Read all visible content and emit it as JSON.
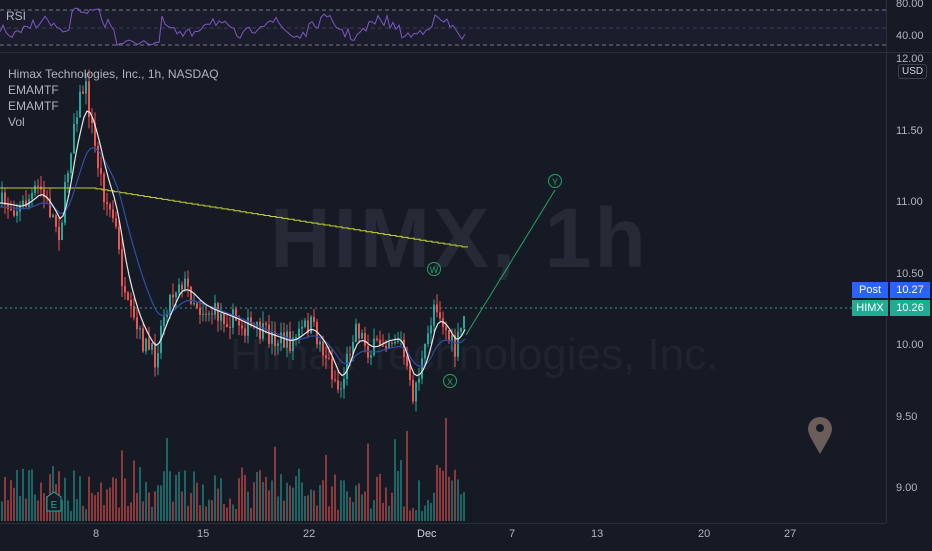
{
  "rsi": {
    "label": "RSI",
    "levels": [
      "80.00",
      "40.00"
    ]
  },
  "legend": {
    "title": "Himax Technologies, Inc., 1h, NASDAQ",
    "indicators": [
      "EMAMTF",
      "EMAMTF",
      "Vol"
    ]
  },
  "watermark": {
    "symbol": "HIMX, 1h",
    "company": "Himax Technologies, Inc."
  },
  "price_axis": {
    "currency": "USD",
    "labels": [
      "12.00",
      "11.50",
      "11.00",
      "10.50",
      "10.00",
      "9.50",
      "9.00"
    ]
  },
  "time_axis": {
    "labels": [
      "8",
      "15",
      "22",
      "Dec",
      "7",
      "13",
      "20",
      "27"
    ]
  },
  "price_tags": {
    "post": {
      "name": "Post",
      "value": "10.27",
      "color": "#2962ff"
    },
    "last": {
      "name": "HIMX",
      "value": "10.26",
      "color": "#22ab94"
    }
  },
  "wave_labels": [
    "W",
    "X",
    "Y"
  ],
  "earnings_marker": "E",
  "colors": {
    "up": "#26a69a",
    "down": "#ef5350",
    "ema_white": "#e8e8e8",
    "ema_blue": "#2f4fa8",
    "ema_yellow": "#c6d32a",
    "wave": "#26a269",
    "rsi_line": "#7e57c2"
  }
}
